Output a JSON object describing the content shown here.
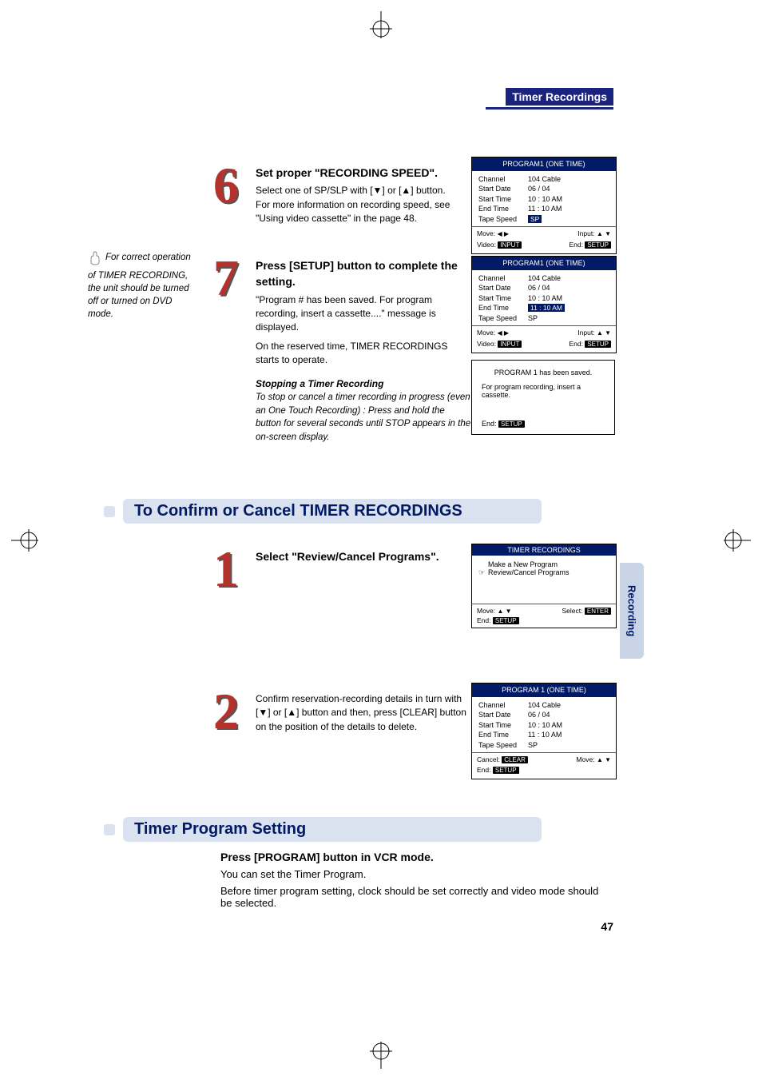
{
  "header": {
    "tag": "Timer Recordings"
  },
  "step6": {
    "num": "6",
    "title": "Set proper \"RECORDING SPEED\".",
    "line1": "Select one of SP/SLP with [▼] or [▲] button.",
    "line2": "For more information on recording speed, see \"Using video cassette\" in the page 48."
  },
  "tip": {
    "text": "For correct operation of TIMER RECORDING, the unit should be turned off or turned on DVD mode."
  },
  "step7": {
    "num": "7",
    "title": "Press [SETUP] button to complete the setting.",
    "line1": "\"Program # has been saved. For program recording, insert a cassette....\" message is displayed.",
    "line2": "On the reserved time, TIMER RECORDINGS starts to operate.",
    "subtitle": "Stopping a Timer Recording",
    "italic": "To stop or cancel a timer recording in progress (even an One Touch Recording) : Press and hold the button for several seconds until STOP appears in the on-screen display."
  },
  "osd6": {
    "title": "PROGRAM1  (ONE TIME)",
    "rows": [
      {
        "label": "Channel",
        "value": "104 Cable"
      },
      {
        "label": "Start Date",
        "value": "06 / 04"
      },
      {
        "label": "Start Time",
        "value": "10 : 10 AM"
      },
      {
        "label": "End Time",
        "value": "11 : 10 AM"
      },
      {
        "label": "Tape Speed",
        "value": "SP",
        "highlight": true
      }
    ],
    "footer": {
      "move": "Move:",
      "move_sym": "◀ ▶",
      "video": "Video:",
      "video_btn": "INPUT",
      "input": "Input:",
      "input_sym": "▲ ▼",
      "end": "End:",
      "end_btn": "SETUP"
    }
  },
  "osd7": {
    "title": "PROGRAM1  (ONE TIME)",
    "rows": [
      {
        "label": "Channel",
        "value": "104 Cable"
      },
      {
        "label": "Start Date",
        "value": "06 / 04"
      },
      {
        "label": "Start Time",
        "value": "10 : 10 AM"
      },
      {
        "label": "End Time",
        "value": "11 : 10 AM",
        "highlight": true
      },
      {
        "label": "Tape Speed",
        "value": "SP"
      }
    ],
    "footer": {
      "move": "Move:",
      "move_sym": "◀ ▶",
      "video": "Video:",
      "video_btn": "INPUT",
      "input": "Input:",
      "input_sym": "▲ ▼",
      "end": "End:",
      "end_btn": "SETUP"
    }
  },
  "osd_msg": {
    "line1": "PROGRAM 1 has been saved.",
    "line2": "For program recording, insert a cassette.",
    "end": "End:",
    "end_btn": "SETUP"
  },
  "section_confirm": {
    "title": "To Confirm or Cancel TIMER RECORDINGS"
  },
  "step1b": {
    "num": "1",
    "title": "Select \"Review/Cancel Programs\"."
  },
  "osd_menu": {
    "title": "TIMER RECORDINGS",
    "item1": "Make a New Program",
    "item2": "Review/Cancel Programs",
    "footer": {
      "move": "Move:",
      "move_sym": "▲ ▼",
      "end": "End:",
      "end_btn": "SETUP",
      "select": "Select:",
      "select_btn": "ENTER"
    }
  },
  "step2b": {
    "num": "2",
    "text": "Confirm reservation-recording details in turn with [▼] or [▲] button and then, press [CLEAR] button on the position of the details to delete."
  },
  "osd_conf": {
    "title": "PROGRAM 1 (ONE TIME)",
    "rows": [
      {
        "label": "Channel",
        "value": "104 Cable"
      },
      {
        "label": "Start Date",
        "value": "06 / 04"
      },
      {
        "label": "Start Time",
        "value": "10 : 10 AM"
      },
      {
        "label": "End Time",
        "value": "11 : 10 AM"
      },
      {
        "label": "Tape Speed",
        "value": "SP"
      }
    ],
    "footer": {
      "cancel": "Cancel:",
      "cancel_btn": "CLEAR",
      "move": "Move:",
      "move_sym": "▲ ▼",
      "end": "End:",
      "end_btn": "SETUP"
    }
  },
  "sidebar": {
    "label": "Recording"
  },
  "section_timer": {
    "title": "Timer Program Setting"
  },
  "bottom": {
    "title": "Press [PROGRAM] button in VCR mode.",
    "line1": "You can set the Timer Program.",
    "line2": "Before timer program setting, clock should be set correctly and video mode should be selected."
  },
  "page_num": "47"
}
